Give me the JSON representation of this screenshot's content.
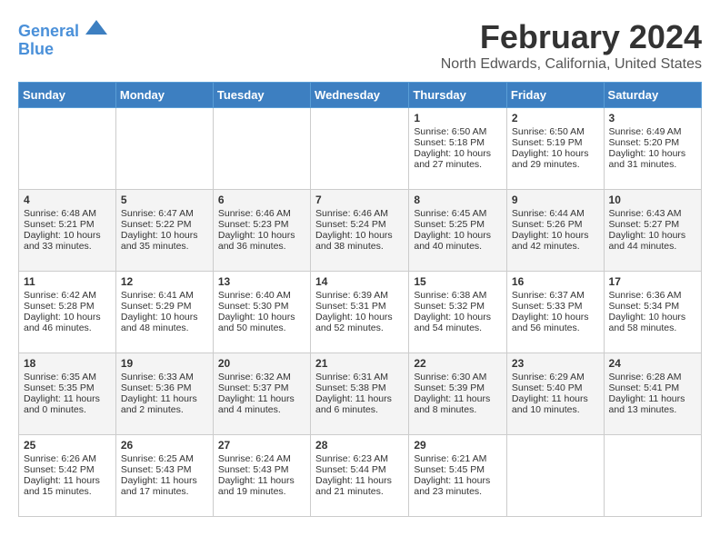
{
  "logo": {
    "line1": "General",
    "line2": "Blue"
  },
  "title": "February 2024",
  "subtitle": "North Edwards, California, United States",
  "days_of_week": [
    "Sunday",
    "Monday",
    "Tuesday",
    "Wednesday",
    "Thursday",
    "Friday",
    "Saturday"
  ],
  "weeks": [
    [
      {
        "day": "",
        "sunrise": "",
        "sunset": "",
        "daylight": ""
      },
      {
        "day": "",
        "sunrise": "",
        "sunset": "",
        "daylight": ""
      },
      {
        "day": "",
        "sunrise": "",
        "sunset": "",
        "daylight": ""
      },
      {
        "day": "",
        "sunrise": "",
        "sunset": "",
        "daylight": ""
      },
      {
        "day": "1",
        "sunrise": "6:50 AM",
        "sunset": "5:18 PM",
        "daylight": "10 hours and 27 minutes."
      },
      {
        "day": "2",
        "sunrise": "6:50 AM",
        "sunset": "5:19 PM",
        "daylight": "10 hours and 29 minutes."
      },
      {
        "day": "3",
        "sunrise": "6:49 AM",
        "sunset": "5:20 PM",
        "daylight": "10 hours and 31 minutes."
      }
    ],
    [
      {
        "day": "4",
        "sunrise": "6:48 AM",
        "sunset": "5:21 PM",
        "daylight": "10 hours and 33 minutes."
      },
      {
        "day": "5",
        "sunrise": "6:47 AM",
        "sunset": "5:22 PM",
        "daylight": "10 hours and 35 minutes."
      },
      {
        "day": "6",
        "sunrise": "6:46 AM",
        "sunset": "5:23 PM",
        "daylight": "10 hours and 36 minutes."
      },
      {
        "day": "7",
        "sunrise": "6:46 AM",
        "sunset": "5:24 PM",
        "daylight": "10 hours and 38 minutes."
      },
      {
        "day": "8",
        "sunrise": "6:45 AM",
        "sunset": "5:25 PM",
        "daylight": "10 hours and 40 minutes."
      },
      {
        "day": "9",
        "sunrise": "6:44 AM",
        "sunset": "5:26 PM",
        "daylight": "10 hours and 42 minutes."
      },
      {
        "day": "10",
        "sunrise": "6:43 AM",
        "sunset": "5:27 PM",
        "daylight": "10 hours and 44 minutes."
      }
    ],
    [
      {
        "day": "11",
        "sunrise": "6:42 AM",
        "sunset": "5:28 PM",
        "daylight": "10 hours and 46 minutes."
      },
      {
        "day": "12",
        "sunrise": "6:41 AM",
        "sunset": "5:29 PM",
        "daylight": "10 hours and 48 minutes."
      },
      {
        "day": "13",
        "sunrise": "6:40 AM",
        "sunset": "5:30 PM",
        "daylight": "10 hours and 50 minutes."
      },
      {
        "day": "14",
        "sunrise": "6:39 AM",
        "sunset": "5:31 PM",
        "daylight": "10 hours and 52 minutes."
      },
      {
        "day": "15",
        "sunrise": "6:38 AM",
        "sunset": "5:32 PM",
        "daylight": "10 hours and 54 minutes."
      },
      {
        "day": "16",
        "sunrise": "6:37 AM",
        "sunset": "5:33 PM",
        "daylight": "10 hours and 56 minutes."
      },
      {
        "day": "17",
        "sunrise": "6:36 AM",
        "sunset": "5:34 PM",
        "daylight": "10 hours and 58 minutes."
      }
    ],
    [
      {
        "day": "18",
        "sunrise": "6:35 AM",
        "sunset": "5:35 PM",
        "daylight": "11 hours and 0 minutes."
      },
      {
        "day": "19",
        "sunrise": "6:33 AM",
        "sunset": "5:36 PM",
        "daylight": "11 hours and 2 minutes."
      },
      {
        "day": "20",
        "sunrise": "6:32 AM",
        "sunset": "5:37 PM",
        "daylight": "11 hours and 4 minutes."
      },
      {
        "day": "21",
        "sunrise": "6:31 AM",
        "sunset": "5:38 PM",
        "daylight": "11 hours and 6 minutes."
      },
      {
        "day": "22",
        "sunrise": "6:30 AM",
        "sunset": "5:39 PM",
        "daylight": "11 hours and 8 minutes."
      },
      {
        "day": "23",
        "sunrise": "6:29 AM",
        "sunset": "5:40 PM",
        "daylight": "11 hours and 10 minutes."
      },
      {
        "day": "24",
        "sunrise": "6:28 AM",
        "sunset": "5:41 PM",
        "daylight": "11 hours and 13 minutes."
      }
    ],
    [
      {
        "day": "25",
        "sunrise": "6:26 AM",
        "sunset": "5:42 PM",
        "daylight": "11 hours and 15 minutes."
      },
      {
        "day": "26",
        "sunrise": "6:25 AM",
        "sunset": "5:43 PM",
        "daylight": "11 hours and 17 minutes."
      },
      {
        "day": "27",
        "sunrise": "6:24 AM",
        "sunset": "5:43 PM",
        "daylight": "11 hours and 19 minutes."
      },
      {
        "day": "28",
        "sunrise": "6:23 AM",
        "sunset": "5:44 PM",
        "daylight": "11 hours and 21 minutes."
      },
      {
        "day": "29",
        "sunrise": "6:21 AM",
        "sunset": "5:45 PM",
        "daylight": "11 hours and 23 minutes."
      },
      {
        "day": "",
        "sunrise": "",
        "sunset": "",
        "daylight": ""
      },
      {
        "day": "",
        "sunrise": "",
        "sunset": "",
        "daylight": ""
      }
    ]
  ]
}
